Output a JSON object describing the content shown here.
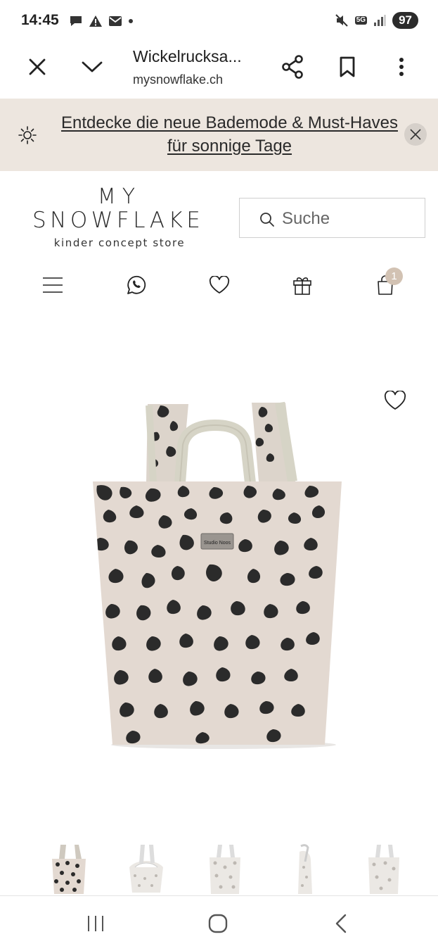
{
  "status_bar": {
    "time": "14:45",
    "network": "5G",
    "battery": "97",
    "left_icons": [
      "chat-bubble-icon",
      "warning-icon",
      "mail-icon",
      "dot-icon"
    ],
    "right_icons": [
      "mute-icon",
      "network-5g-icon",
      "signal-icon",
      "battery-icon"
    ]
  },
  "browser": {
    "title": "Wickelrucksa...",
    "domain": "mysnowflake.ch",
    "icons": [
      "close-icon",
      "chevron-down-icon",
      "share-icon",
      "bookmark-icon",
      "more-vert-icon"
    ]
  },
  "promo": {
    "text": "Entdecke die neue Bademode & Must-Haves für sonnige Tage",
    "icons": [
      "sun-icon",
      "close-icon"
    ]
  },
  "logo": {
    "line1": "MY",
    "line2": "SNOWFLAKE",
    "line3": "kinder concept store"
  },
  "search": {
    "placeholder": "Suche"
  },
  "nav": {
    "items": [
      "menu-icon",
      "whatsapp-icon",
      "heart-icon",
      "gift-icon",
      "shopping-bag-icon"
    ],
    "cart_count": "1"
  },
  "product": {
    "image_label": "Studio Noos",
    "wishlist_icon": "heart-icon",
    "colors": {
      "bag_base": "#e3d9d1",
      "spots": "#2b2b2b",
      "strap": "#d6d4c6",
      "accent": "#d2c2b3",
      "promo_bg": "#ede6df"
    }
  },
  "thumbnails": [
    "thumb-1",
    "thumb-2",
    "thumb-3",
    "thumb-4",
    "thumb-5"
  ],
  "android_nav": [
    "recent-apps-icon",
    "home-icon",
    "back-icon"
  ]
}
